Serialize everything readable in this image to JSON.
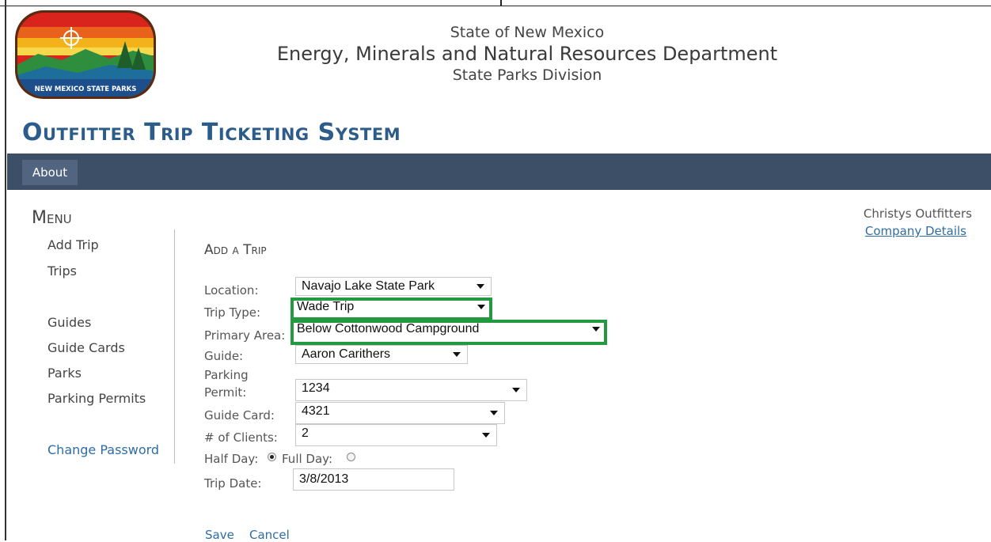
{
  "header": {
    "logo_text": "NEW MEXICO STATE PARKS",
    "line1": "State of New Mexico",
    "line2": "Energy, Minerals and Natural Resources Department",
    "line3": "State Parks Division",
    "app_title": "Outfitter Trip Ticketing System"
  },
  "nav": {
    "about": "About"
  },
  "sidebar": {
    "title": "Menu",
    "items": [
      {
        "label": "Add Trip"
      },
      {
        "label": "Trips"
      },
      {
        "label": "Guides"
      },
      {
        "label": "Guide Cards"
      },
      {
        "label": "Parks"
      },
      {
        "label": "Parking Permits"
      },
      {
        "label": "Change Password"
      }
    ]
  },
  "company": {
    "name": "Christys Outfitters",
    "details_link": "Company Details"
  },
  "form": {
    "title": "Add a Trip",
    "location": {
      "label": "Location:",
      "value": "Navajo Lake State Park"
    },
    "trip_type": {
      "label": "Trip Type:",
      "value": "Wade Trip"
    },
    "primary_area": {
      "label": "Primary Area:",
      "value": "Below Cottonwood Campground"
    },
    "guide": {
      "label": "Guide:",
      "value": "Aaron Carithers"
    },
    "parking_permit": {
      "label_line1": "Parking",
      "label_line2": "Permit:",
      "value": "1234"
    },
    "guide_card": {
      "label": "Guide Card:",
      "value": "4321"
    },
    "clients": {
      "label": "# of Clients:",
      "value": "2"
    },
    "half_day": {
      "label": "Half Day:",
      "selected": true
    },
    "full_day": {
      "label": "Full Day:",
      "selected": false
    },
    "trip_date": {
      "label": "Trip Date:",
      "value": "3/8/2013"
    },
    "save": "Save",
    "cancel": "Cancel"
  },
  "colors": {
    "title_blue": "#2b5c8a",
    "navbar": "#3c4f67",
    "link_blue": "#2e6da4",
    "highlight_green": "#239a3f"
  }
}
